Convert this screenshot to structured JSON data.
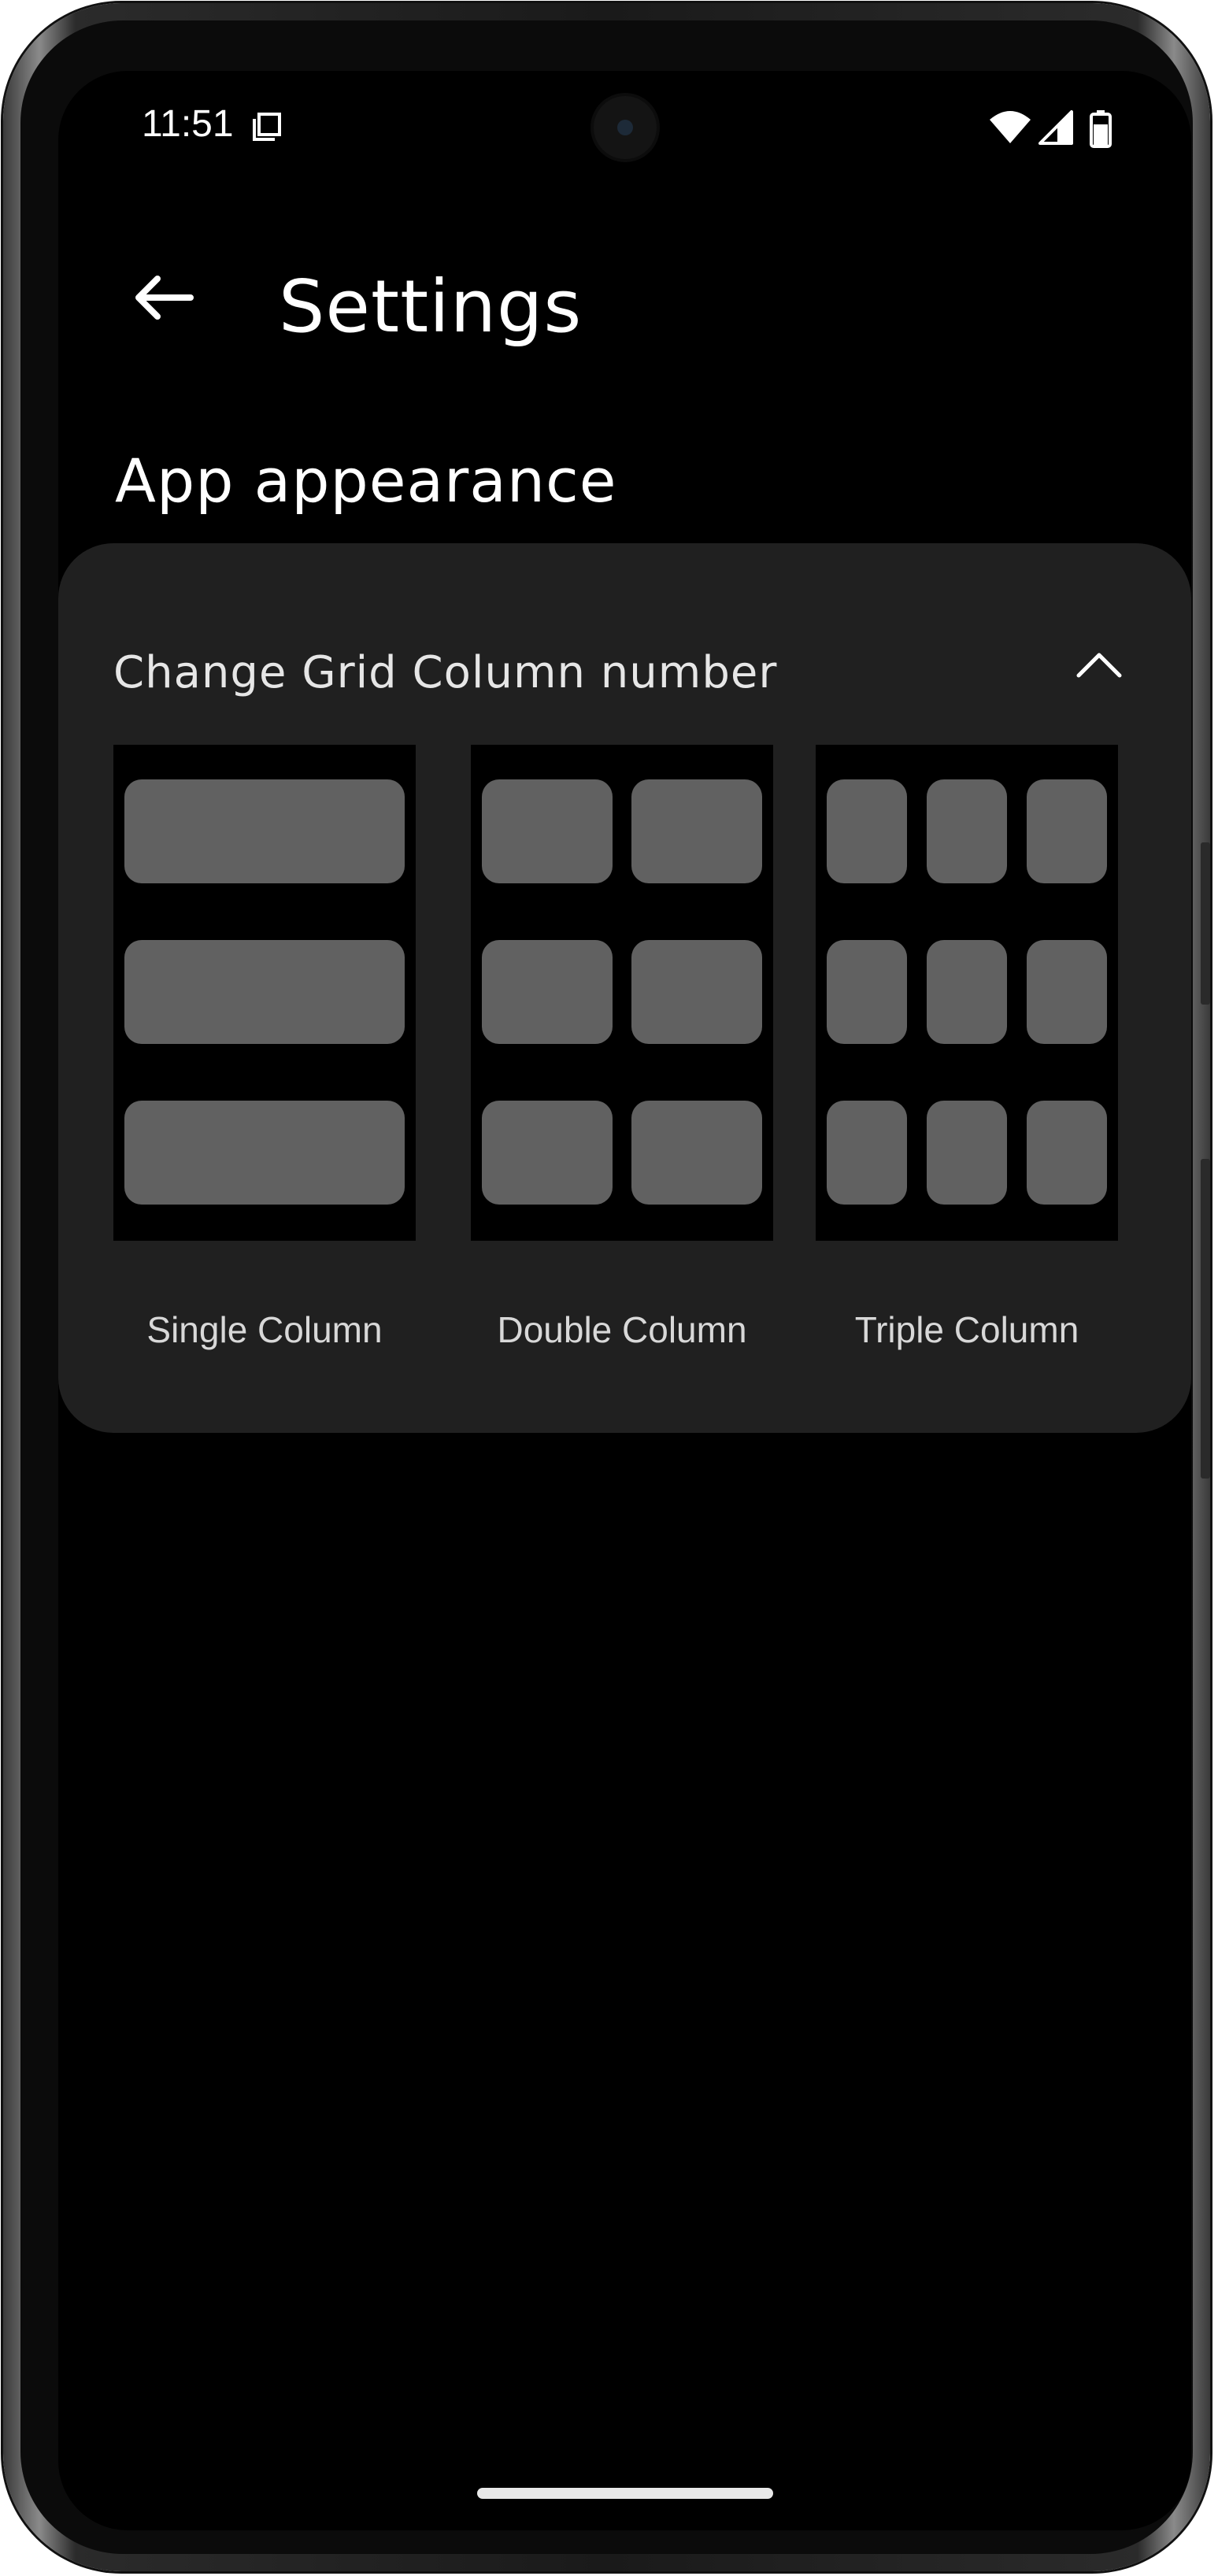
{
  "status_bar": {
    "time": "11:51",
    "sim_icon": "sim-card-icon",
    "wifi_icon": "wifi-icon",
    "signal_icon": "signal-icon",
    "battery_icon": "battery-icon"
  },
  "app_bar": {
    "back_icon": "arrow-back-icon",
    "title": "Settings"
  },
  "section": {
    "title": "App appearance"
  },
  "grid_card": {
    "header_label": "Change Grid Column number",
    "collapse_icon": "chevron-up-icon",
    "options": [
      {
        "label": "Single Column",
        "columns": 1
      },
      {
        "label": "Double Column",
        "columns": 2
      },
      {
        "label": "Triple Column",
        "columns": 3
      }
    ]
  },
  "colors": {
    "background": "#000000",
    "card": "#202020",
    "tile": "#616161",
    "text_primary": "#ffffff",
    "text_secondary": "#d8d8d8"
  }
}
